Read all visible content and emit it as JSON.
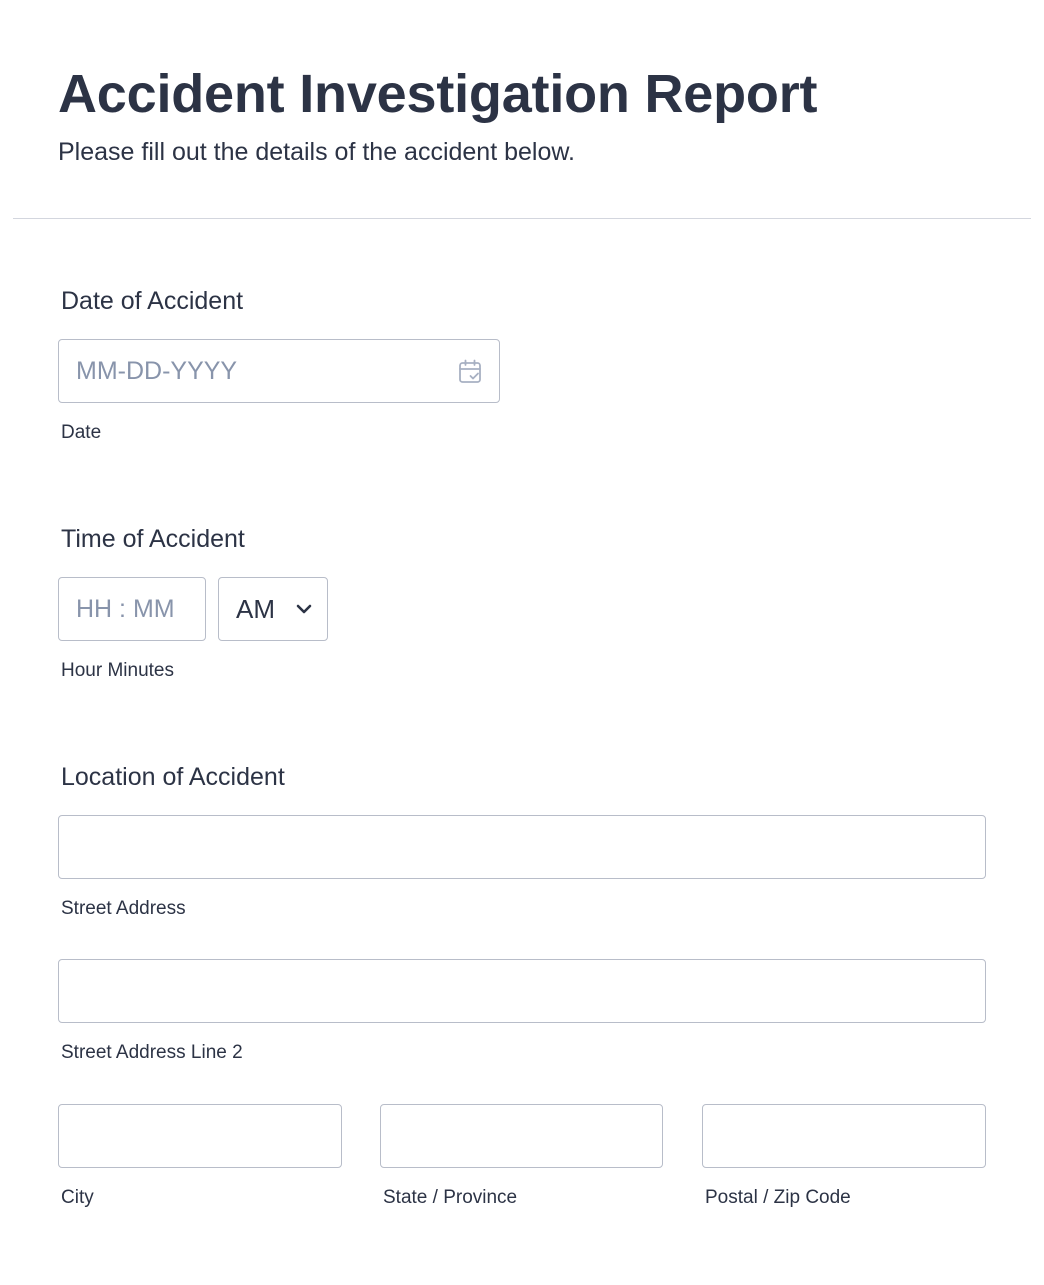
{
  "form": {
    "title": "Accident Investigation Report",
    "subtitle": "Please fill out the details of the accident below."
  },
  "date_field": {
    "label": "Date of Accident",
    "placeholder": "MM-DD-YYYY",
    "sublabel": "Date",
    "icon": "calendar-icon"
  },
  "time_field": {
    "label": "Time of Accident",
    "placeholder": "HH : MM",
    "ampm_value": "AM",
    "sublabel": "Hour Minutes",
    "icon": "chevron-down-icon"
  },
  "location_field": {
    "label": "Location of Accident",
    "street_value": "",
    "street_sublabel": "Street Address",
    "street2_value": "",
    "street2_sublabel": "Street Address Line 2",
    "city_value": "",
    "city_sublabel": "City",
    "state_value": "",
    "state_sublabel": "State / Province",
    "zip_value": "",
    "zip_sublabel": "Postal / Zip Code"
  },
  "colors": {
    "text": "#2c3345",
    "placeholder": "#8894ab",
    "border": "#b8bdc9",
    "divider": "#d3d6de"
  }
}
